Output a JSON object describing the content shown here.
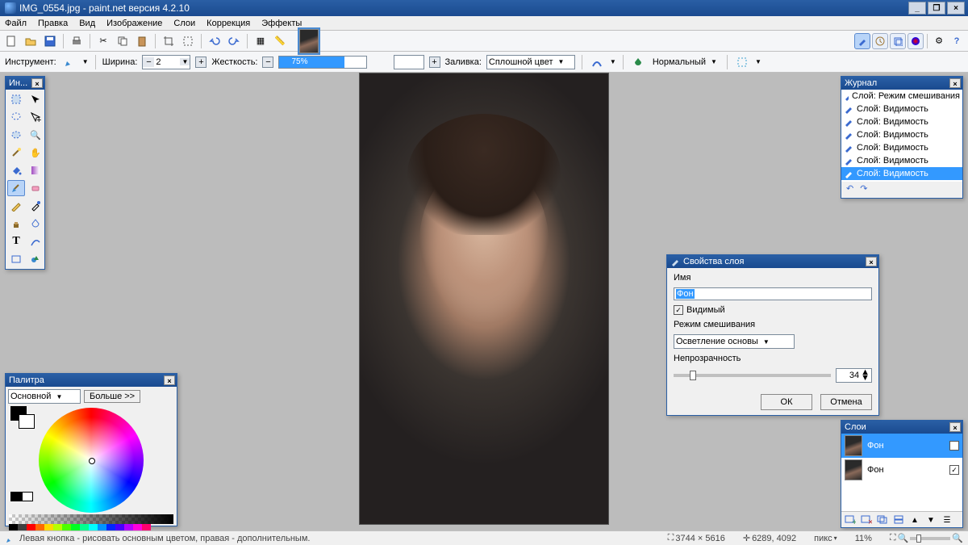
{
  "title": "IMG_0554.jpg - paint.net версия 4.2.10",
  "menu": [
    "Файл",
    "Правка",
    "Вид",
    "Изображение",
    "Слои",
    "Коррекция",
    "Эффекты"
  ],
  "options": {
    "tool_label": "Инструмент:",
    "width_label": "Ширина:",
    "width_value": "2",
    "hardness_label": "Жесткость:",
    "hardness_value": "75%",
    "fill_label": "Заливка:",
    "fill_value": "Сплошной цвет",
    "blend_label": "Нормальный"
  },
  "tools_title": "Ин...",
  "palette": {
    "title": "Палитра",
    "primary": "Основной",
    "more": "Больше >>"
  },
  "history": {
    "title": "Журнал",
    "items": [
      "Слой: Режим смешивания",
      "Слой: Видимость",
      "Слой: Видимость",
      "Слой: Видимость",
      "Слой: Видимость",
      "Слой: Видимость",
      "Слой: Видимость"
    ],
    "selected": 6
  },
  "layers": {
    "title": "Слои",
    "items": [
      "Фон",
      "Фон"
    ],
    "selected": 0
  },
  "layerprops": {
    "title": "Свойства слоя",
    "name_label": "Имя",
    "name_value": "Фон",
    "visible_label": "Видимый",
    "blend_label": "Режим смешивания",
    "blend_value": "Осветление основы",
    "opacity_label": "Непрозрачность",
    "opacity_value": "34",
    "ok": "ОК",
    "cancel": "Отмена"
  },
  "status": {
    "hint": "Левая кнопка - рисовать основным цветом, правая - дополнительным.",
    "dims": "3744 × 5616",
    "cursor": "6289, 4092",
    "unit": "пикс",
    "zoom": "11%"
  }
}
